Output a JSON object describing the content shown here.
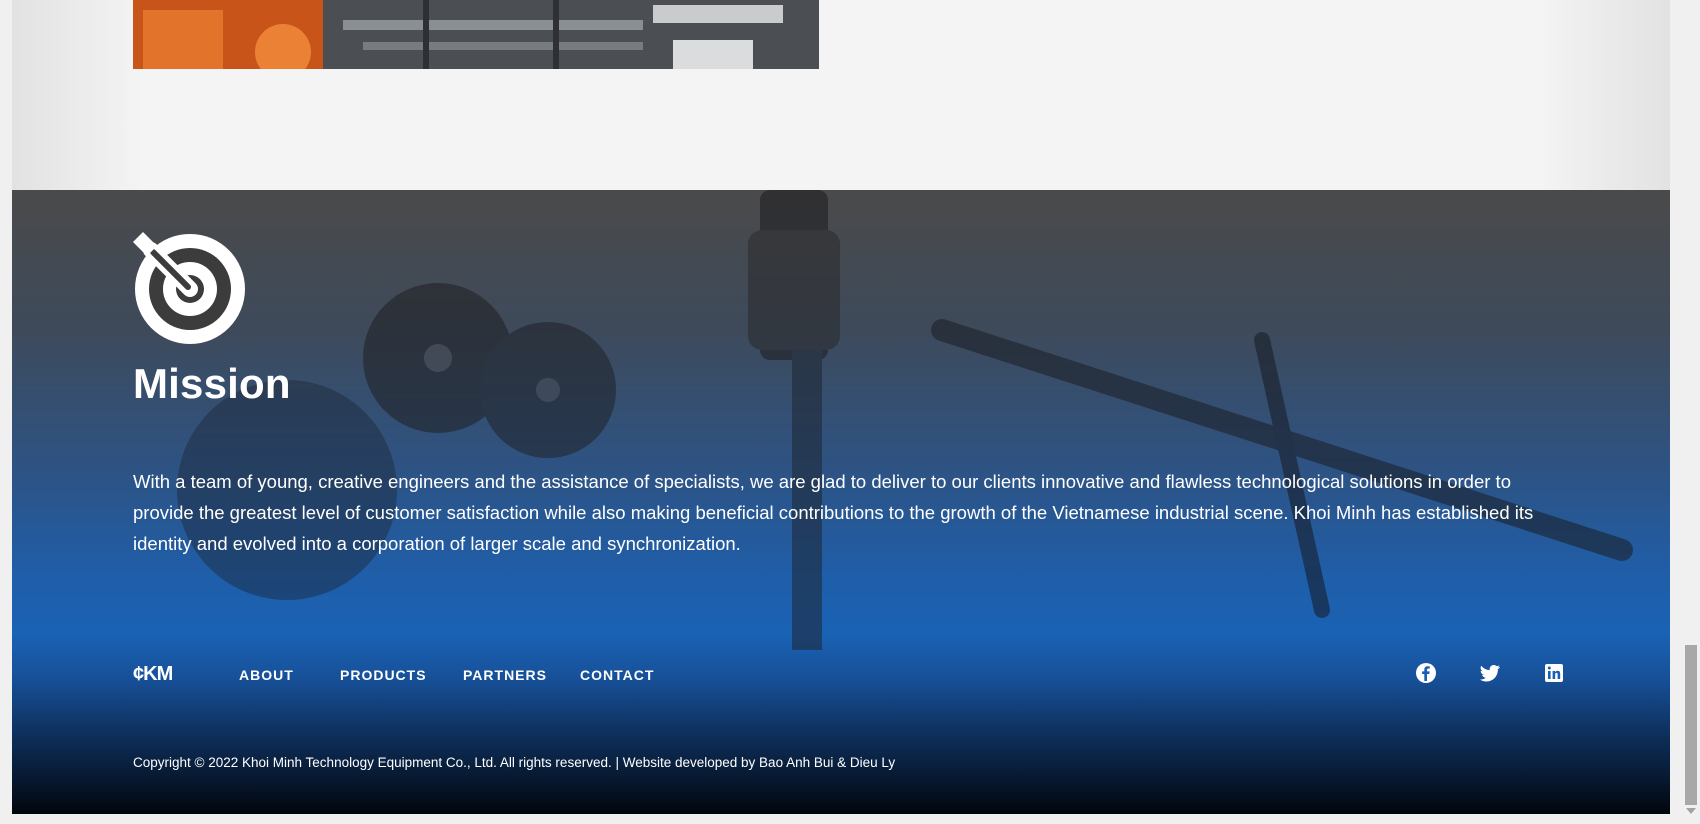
{
  "mission": {
    "title": "Mission",
    "text": "With a team of young, creative engineers and the assistance of specialists, we are glad to deliver to our clients innovative and flawless technological solutions in order to provide the greatest level of customer satisfaction while also making beneficial contributions to the growth of the Vietnamese industrial scene. Khoi Minh has established its identity and evolved into a corporation of larger scale and synchronization."
  },
  "footer": {
    "logo": "¢KM",
    "nav": [
      "ABOUT",
      "PRODUCTS",
      "PARTNERS",
      "CONTACT"
    ],
    "social": [
      "facebook-icon",
      "twitter-icon",
      "linkedin-icon"
    ],
    "copyright": "Copyright © 2022 Khoi Minh Technology Equipment Co., Ltd. All rights reserved. | Website developed by Bao Anh Bui & Dieu Ly"
  }
}
